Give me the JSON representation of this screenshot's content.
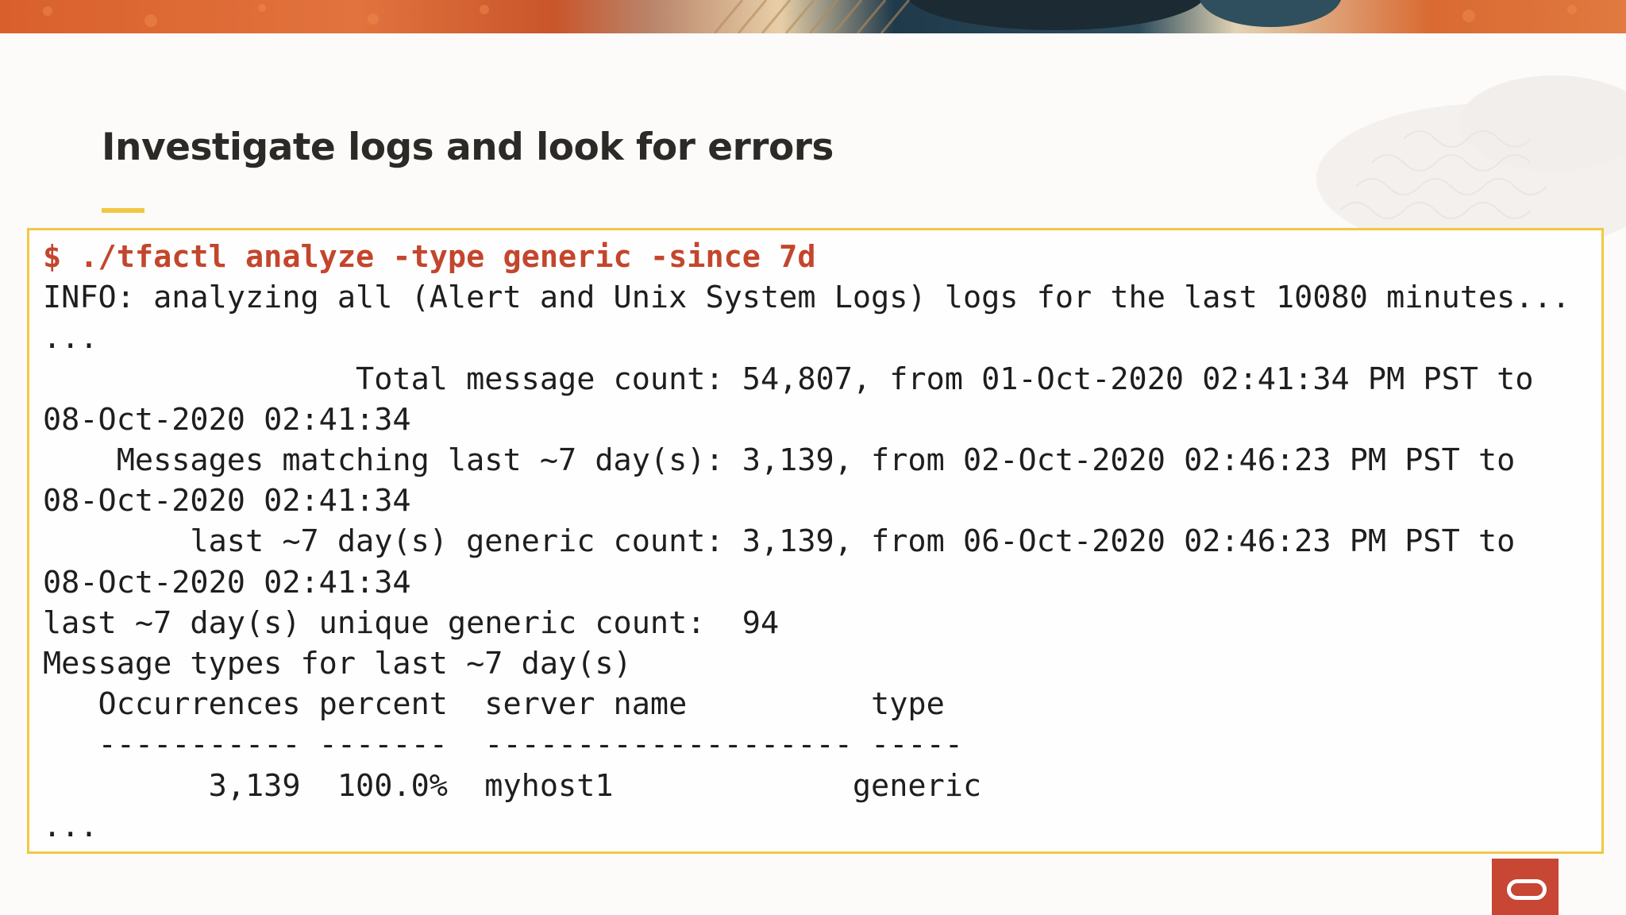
{
  "slide": {
    "title": "Investigate logs and look for errors"
  },
  "terminal": {
    "command": "$ ./tfactl analyze -type generic -since 7d",
    "lines": [
      "INFO: analyzing all (Alert and Unix System Logs) logs for the last 10080 minutes...",
      "...",
      "                 Total message count: 54,807, from 01-Oct-2020 02:41:34 PM PST to",
      "08-Oct-2020 02:41:34",
      "    Messages matching last ~7 day(s): 3,139, from 02-Oct-2020 02:46:23 PM PST to",
      "08-Oct-2020 02:41:34",
      "        last ~7 day(s) generic count: 3,139, from 06-Oct-2020 02:46:23 PM PST to",
      "08-Oct-2020 02:41:34",
      "last ~7 day(s) unique generic count:  94",
      "Message types for last ~7 day(s)",
      "   Occurrences percent  server name          type",
      "   ----------- -------  -------------------- -----",
      "         3,139  100.0%  myhost1             generic",
      "..."
    ]
  },
  "colors": {
    "accent": "#f2c744",
    "command": "#c3462c",
    "brand": "#c74634"
  },
  "icons": {
    "logo": "oracle-logo-icon"
  }
}
